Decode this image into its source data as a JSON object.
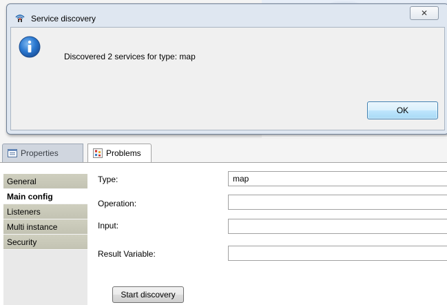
{
  "dialog": {
    "title": "Service discovery",
    "close_glyph": "✕",
    "message": "Discovered 2 services for type: map",
    "ok_label": "OK",
    "icons": {
      "app": "service-discovery-icon",
      "info": "information-icon"
    }
  },
  "view_tabs": [
    {
      "label": "Properties",
      "icon": "properties-icon",
      "active": false
    },
    {
      "label": "Problems",
      "icon": "problems-icon",
      "active": true
    }
  ],
  "sections": [
    {
      "label": "General",
      "active": false
    },
    {
      "label": "Main config",
      "active": true
    },
    {
      "label": "Listeners",
      "active": false
    },
    {
      "label": "Multi instance",
      "active": false
    },
    {
      "label": "Security",
      "active": false
    }
  ],
  "form": {
    "type_label": "Type:",
    "type_value": "map",
    "operation_label": "Operation:",
    "operation_value": "",
    "input_label": "Input:",
    "input_value": "",
    "result_variable_label": "Result Variable:",
    "result_variable_value": "",
    "start_button": "Start discovery"
  },
  "colors": {
    "dialog_frame": "#dfe7f1",
    "ok_button": "#bee6fd",
    "section_tab": "#c9c9b9",
    "info_blue": "#1f6fc9"
  }
}
